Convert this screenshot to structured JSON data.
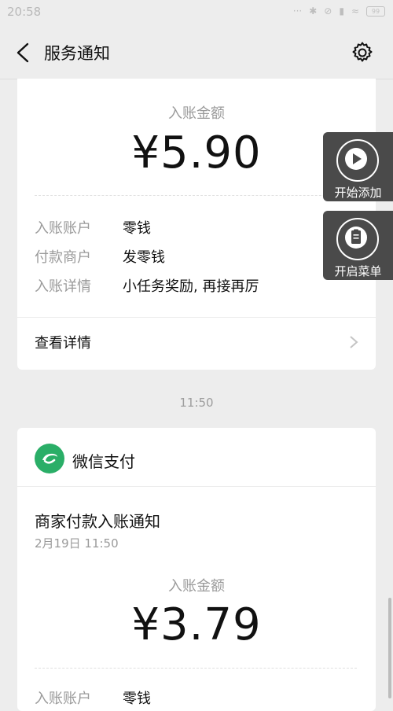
{
  "status_bar": {
    "time": "20:58",
    "battery": "99"
  },
  "nav": {
    "title": "服务通知",
    "back_icon": "chevron-left-icon",
    "settings_icon": "gear-icon"
  },
  "card1": {
    "amount_label": "入账金额",
    "amount": "¥5.90",
    "rows": [
      {
        "key": "入账账户",
        "value": "零钱"
      },
      {
        "key": "付款商户",
        "value": "发零钱"
      },
      {
        "key": "入账详情",
        "value": "小任务奖励, 再接再厉"
      }
    ],
    "detail_link": "查看详情"
  },
  "timestamp": "11:50",
  "card2": {
    "pay_name": "微信支付",
    "notif_title": "商家付款入账通知",
    "notif_date": "2月19日  11:50",
    "amount_label": "入账金额",
    "amount": "¥3.79",
    "rows": [
      {
        "key": "入账账户",
        "value": "零钱"
      }
    ]
  },
  "float_buttons": [
    {
      "label": "开始添加",
      "icon": "play-icon"
    },
    {
      "label": "开启菜单",
      "icon": "clipboard-icon"
    }
  ],
  "colors": {
    "wechat_pay_green": "#2aae67",
    "float_bg": "#4a4a4a"
  }
}
